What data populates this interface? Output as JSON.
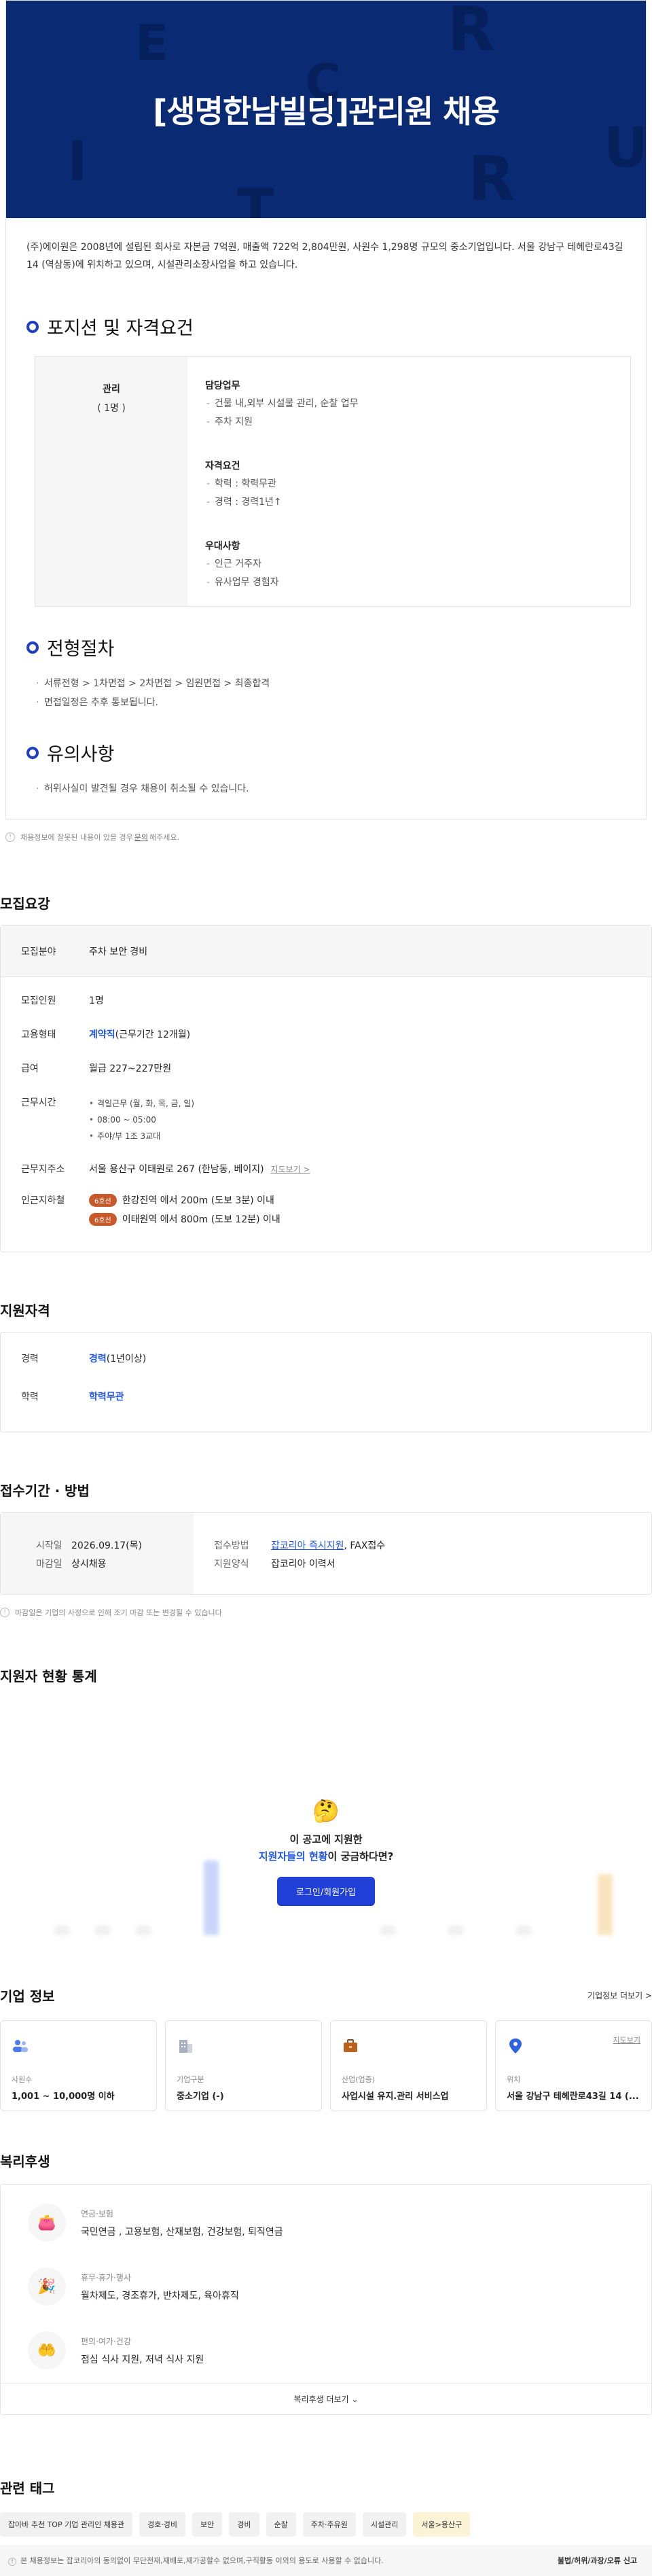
{
  "hero": {
    "title": "[생명한남빌딩]관리원 채용",
    "letters": [
      "E",
      "C",
      "R",
      "U",
      "I",
      "T",
      "R"
    ]
  },
  "intro": "(주)에이원은 2008년에 설립된 회사로 자본금 7억원, 매출액 722억 2,804만원, 사원수 1,298명 규모의 중소기업입니다. 서울 강남구 테헤란로43길 14 (역삼동)에 위치하고 있으며, 시설관리소장사업을 하고 있습니다.",
  "position": {
    "title": "포지션 및 자격요건",
    "name": "관리",
    "count": "( 1명 )",
    "groups": [
      {
        "title": "담당업무",
        "items": [
          "건물 내,외부 시설물 관리, 순찰 업무",
          "주차 지원"
        ]
      },
      {
        "title": "자격요건",
        "items": [
          "학력 : 학력무관",
          "경력 : 경력1년↑"
        ]
      },
      {
        "title": "우대사항",
        "items": [
          "인근 거주자",
          "유사업무 경험자"
        ]
      }
    ]
  },
  "process": {
    "title": "전형절차",
    "items": [
      "서류전형 > 1차면접 > 2차면접 > 임원면접 > 최종합격",
      "면접일정은 추후 통보됩니다."
    ]
  },
  "caution": {
    "title": "유의사항",
    "items": [
      "허위사실이 발견될 경우 채용이 취소될 수 있습니다."
    ]
  },
  "notice": {
    "before": "채용정보에 잘못된 내용이 있을 경우",
    "link": "문의",
    "after": "해주세요."
  },
  "recruit": {
    "title": "모집요강",
    "field_label": "모집분야",
    "field_value": "주차 보안 경비",
    "count_label": "모집인원",
    "count_value": "1명",
    "type_label": "고용형태",
    "type_value_strong": "계약직",
    "type_value_rest": "(근무기간 12개월)",
    "salary_label": "급여",
    "salary_value": "월급 227~227만원",
    "time_label": "근무시간",
    "time_items": [
      "격일근무 (월, 화, 목, 금, 일)",
      "08:00 ~ 05:00",
      "주야/부 1조 3교대"
    ],
    "addr_label": "근무지주소",
    "addr_value": "서울 용산구 이태원로 267 (한남동, 베이지)",
    "map_link": "지도보기 >",
    "subway_label": "인근지하철",
    "stations": [
      {
        "badge": "6호선",
        "text": "한강진역 에서 200m (도보 3분) 이내"
      },
      {
        "badge": "6호선",
        "text": "이태원역 에서 800m (도보 12분) 이내"
      }
    ]
  },
  "qualification": {
    "title": "지원자격",
    "career_label": "경력",
    "career_strong": "경력",
    "career_rest": "(1년이상)",
    "edu_label": "학력",
    "edu_value": "학력무관"
  },
  "period": {
    "title": "접수기간 · 방법",
    "start_label": "시작일",
    "start_value": "2026.09.17(목)",
    "end_label": "마감일",
    "end_value": "상시채용",
    "method_label": "접수방법",
    "method_link": "잡코리아 즉시지원",
    "method_rest": ", FAX접수",
    "form_label": "지원양식",
    "form_value": "잡코리아 이력서",
    "notice": "마감일은 기업의 사정으로 인해 조기 마감 또는 변경될 수 있습니다"
  },
  "stats": {
    "title": "지원자 현황 통계",
    "q1": "이 공고에 지원한",
    "q2_hl": "지원자들의 현황",
    "q2_rest": "이 궁금하다면?",
    "button": "로그인/회원가입"
  },
  "company": {
    "title": "기업 정보",
    "more": "기업정보 더보기 >",
    "cards": [
      {
        "label": "사원수",
        "value": "1,001 ~ 10,000명 이하"
      },
      {
        "label": "기업구분",
        "value": "중소기업 (-)"
      },
      {
        "label": "산업(업종)",
        "value": "사업시설 유지.관리 서비스업"
      },
      {
        "label": "위치",
        "value": "서울 강남구 테헤란로43길 14 (...",
        "link": "지도보기"
      }
    ]
  },
  "benefit": {
    "title": "복리후생",
    "items": [
      {
        "cat": "연금·보험",
        "desc": "국민연금 , 고용보험, 산재보험, 건강보험, 퇴직연금"
      },
      {
        "cat": "휴무·휴가·행사",
        "desc": "월차제도, 경조휴가, 반차제도, 육아휴직"
      },
      {
        "cat": "편의·여가·건강",
        "desc": "점심 식사 지원, 저녁 식사 지원"
      }
    ],
    "more": "복리후생 더보기"
  },
  "tags": {
    "title": "관련 태그",
    "items": [
      "잡아바 추천 TOP 기업 관리인 채용관",
      "경호·경비",
      "보안",
      "경비",
      "순찰",
      "주차·주유원",
      "시설관리",
      "서울>용산구"
    ]
  },
  "footer": {
    "left": "본 채용정보는 잡코리아의 동의없이 무단전재,재배포,재가공할수 없으며,구직활동 이외의 용도로 사용할 수 없습니다.",
    "right": "불법/허위/과장/오류 신고"
  },
  "colors": {
    "hero_bg": "#0b2a74",
    "accent": "#1f3fc7",
    "link": "#1f55e0",
    "badge": "#c7592b"
  }
}
